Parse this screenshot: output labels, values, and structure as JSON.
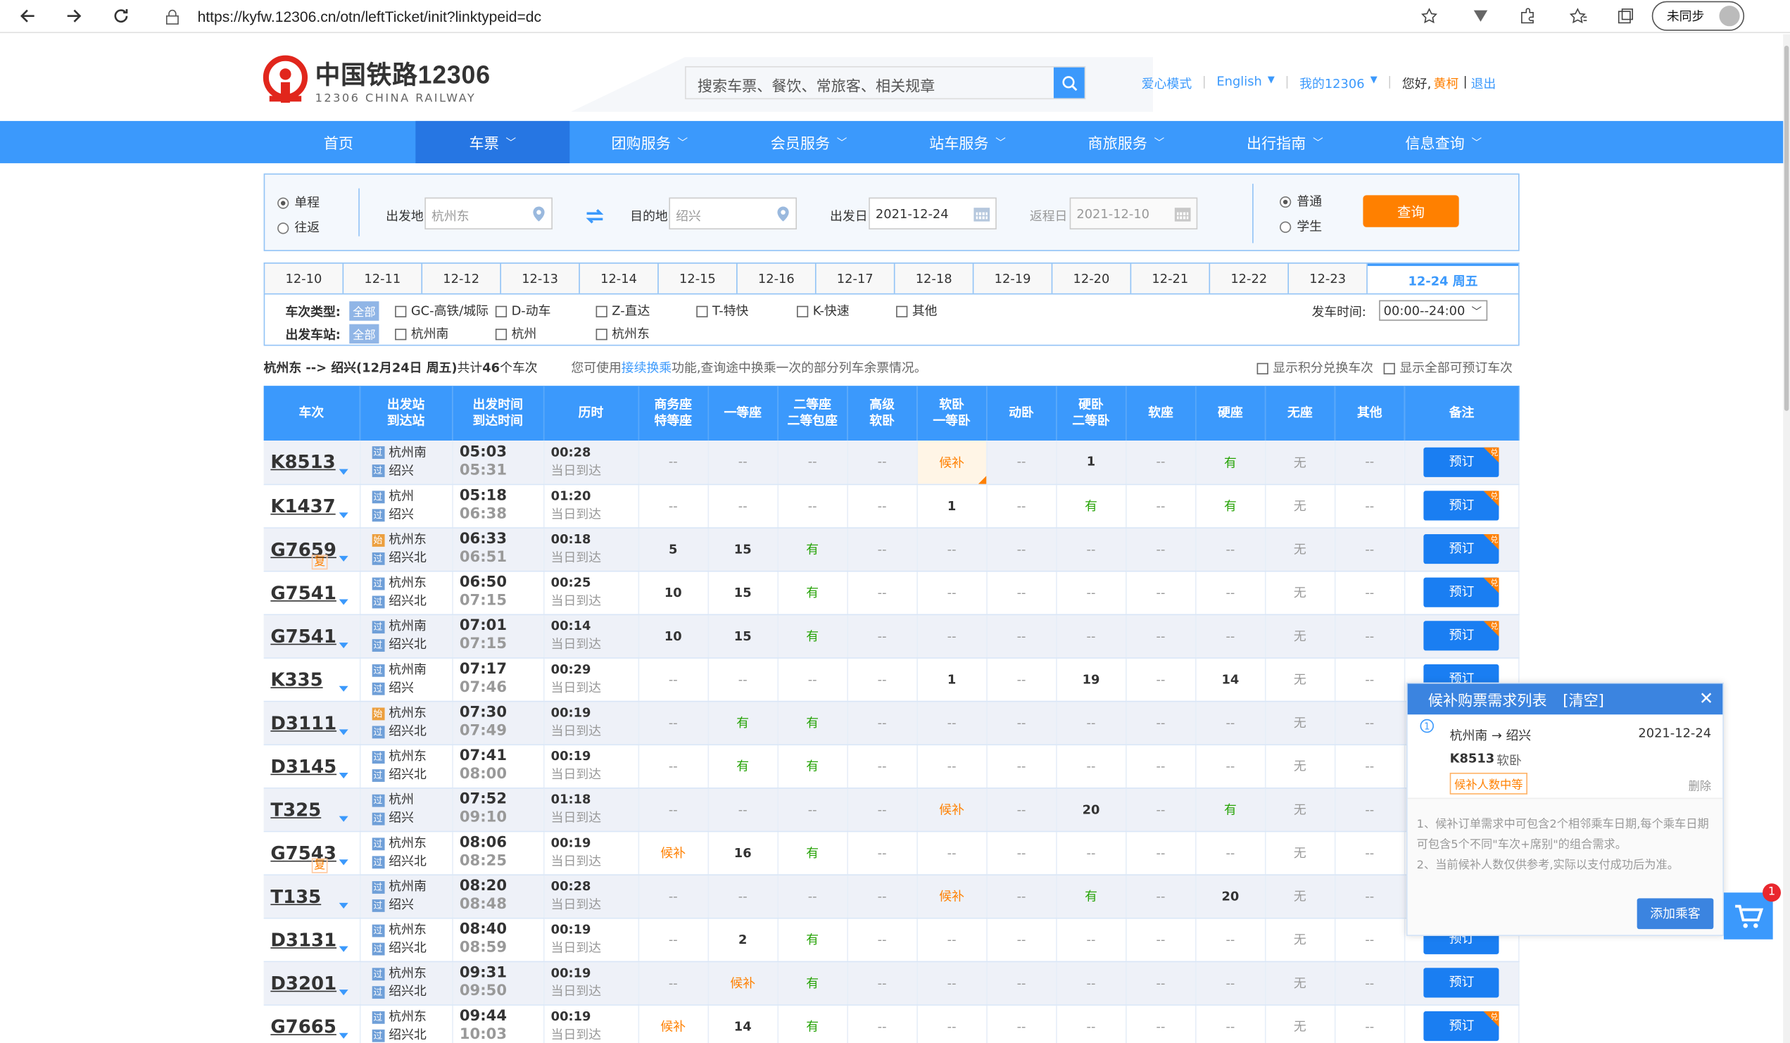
{
  "browser": {
    "url": "https://kyfw.12306.cn/otn/leftTicket/init?linktypeid=dc",
    "sync_label": "未同步"
  },
  "header": {
    "logo_title": "中国铁路12306",
    "logo_sub": "12306 CHINA RAILWAY",
    "search_placeholder": "搜索车票、餐饮、常旅客、相关规章",
    "links": {
      "care": "爱心模式",
      "english": "English",
      "my": "我的12306",
      "hello": "您好,",
      "user": "黄柯",
      "logout": "退出"
    }
  },
  "nav": [
    "首页",
    "车票",
    "团购服务",
    "会员服务",
    "站车服务",
    "商旅服务",
    "出行指南",
    "信息查询"
  ],
  "query": {
    "single": "单程",
    "round": "往返",
    "from_label": "出发地",
    "from": "杭州东",
    "to_label": "目的地",
    "to": "绍兴",
    "date_label": "出发日",
    "date": "2021-12-24",
    "ret_label": "返程日",
    "ret": "2021-12-10",
    "normal": "普通",
    "student": "学生",
    "btn": "查询"
  },
  "dates": [
    "12-10",
    "12-11",
    "12-12",
    "12-13",
    "12-14",
    "12-15",
    "12-16",
    "12-17",
    "12-18",
    "12-19",
    "12-20",
    "12-21",
    "12-22",
    "12-23",
    "12-24 周五"
  ],
  "filter": {
    "type_label": "车次类型:",
    "all": "全部",
    "types": [
      "GC-高铁/城际",
      "D-动车",
      "Z-直达",
      "T-特快",
      "K-快速",
      "其他"
    ],
    "time_label": "发车时间:",
    "time_value": "00:00--24:00",
    "station_label": "出发车站:",
    "stations": [
      "杭州南",
      "杭州",
      "杭州东"
    ]
  },
  "info": {
    "route": "杭州东 --> 绍兴",
    "date": "(12月24日 周五)",
    "total_pre": "共计",
    "total": "46",
    "total_post": "个车次",
    "tip_pre": "您可使用",
    "tip_link": "接续换乘",
    "tip_post": "功能,查询途中换乘一次的部分列车余票情况。",
    "opt1": "显示积分兑换车次",
    "opt2": "显示全部可预订车次"
  },
  "columns": [
    "车次",
    "出发站\n到达站",
    "出发时间\n到达时间",
    "历时",
    "商务座\n特等座",
    "一等座",
    "二等座\n二等包座",
    "高级\n软卧",
    "软卧\n一等卧",
    "动卧",
    "硬卧\n二等卧",
    "软座",
    "硬座",
    "无座",
    "其他",
    "备注"
  ],
  "book_label": "预订",
  "trains": [
    {
      "no": "K8513",
      "fu": "",
      "from": "杭州南",
      "fs": "过",
      "to": "绍兴",
      "dep": "05:03",
      "arr": "05:31",
      "dur": "00:28",
      "day": "当日到达",
      "seats": [
        "--",
        "--",
        "--",
        "--",
        "候补",
        "--",
        "1",
        "--",
        "有",
        "无",
        "--"
      ],
      "dui": true
    },
    {
      "no": "K1437",
      "fu": "",
      "from": "杭州",
      "fs": "过",
      "to": "绍兴",
      "dep": "05:18",
      "arr": "06:38",
      "dur": "01:20",
      "day": "当日到达",
      "seats": [
        "--",
        "--",
        "--",
        "--",
        "1",
        "--",
        "有",
        "--",
        "有",
        "无",
        "--"
      ],
      "dui": true
    },
    {
      "no": "G7659",
      "fu": "复",
      "from": "杭州东",
      "fs": "始",
      "to": "绍兴北",
      "dep": "06:33",
      "arr": "06:51",
      "dur": "00:18",
      "day": "当日到达",
      "seats": [
        "5",
        "15",
        "有",
        "--",
        "--",
        "--",
        "--",
        "--",
        "--",
        "无",
        "--"
      ],
      "dui": true
    },
    {
      "no": "G7541",
      "fu": "",
      "from": "杭州东",
      "fs": "过",
      "to": "绍兴北",
      "dep": "06:50",
      "arr": "07:15",
      "dur": "00:25",
      "day": "当日到达",
      "seats": [
        "10",
        "15",
        "有",
        "--",
        "--",
        "--",
        "--",
        "--",
        "--",
        "无",
        "--"
      ],
      "dui": true
    },
    {
      "no": "G7541",
      "fu": "",
      "from": "杭州南",
      "fs": "过",
      "to": "绍兴北",
      "dep": "07:01",
      "arr": "07:15",
      "dur": "00:14",
      "day": "当日到达",
      "seats": [
        "10",
        "15",
        "有",
        "--",
        "--",
        "--",
        "--",
        "--",
        "--",
        "无",
        "--"
      ],
      "dui": true
    },
    {
      "no": "K335",
      "fu": "",
      "from": "杭州南",
      "fs": "过",
      "to": "绍兴",
      "dep": "07:17",
      "arr": "07:46",
      "dur": "00:29",
      "day": "当日到达",
      "seats": [
        "--",
        "--",
        "--",
        "--",
        "1",
        "--",
        "19",
        "--",
        "14",
        "无",
        "--"
      ],
      "dui": false
    },
    {
      "no": "D3111",
      "fu": "",
      "from": "杭州东",
      "fs": "始",
      "to": "绍兴北",
      "dep": "07:30",
      "arr": "07:49",
      "dur": "00:19",
      "day": "当日到达",
      "seats": [
        "--",
        "有",
        "有",
        "--",
        "--",
        "--",
        "--",
        "--",
        "--",
        "无",
        "--"
      ],
      "dui": false
    },
    {
      "no": "D3145",
      "fu": "",
      "from": "杭州东",
      "fs": "过",
      "to": "绍兴北",
      "dep": "07:41",
      "arr": "08:00",
      "dur": "00:19",
      "day": "当日到达",
      "seats": [
        "--",
        "有",
        "有",
        "--",
        "--",
        "--",
        "--",
        "--",
        "--",
        "无",
        "--"
      ],
      "dui": false
    },
    {
      "no": "T325",
      "fu": "",
      "from": "杭州",
      "fs": "过",
      "to": "绍兴",
      "dep": "07:52",
      "arr": "09:10",
      "dur": "01:18",
      "day": "当日到达",
      "seats": [
        "--",
        "--",
        "--",
        "--",
        "候补",
        "--",
        "20",
        "--",
        "有",
        "无",
        "--"
      ],
      "dui": false
    },
    {
      "no": "G7543",
      "fu": "复",
      "from": "杭州东",
      "fs": "过",
      "to": "绍兴北",
      "dep": "08:06",
      "arr": "08:25",
      "dur": "00:19",
      "day": "当日到达",
      "seats": [
        "候补",
        "16",
        "有",
        "--",
        "--",
        "--",
        "--",
        "--",
        "--",
        "无",
        "--"
      ],
      "dui": false
    },
    {
      "no": "T135",
      "fu": "",
      "from": "杭州南",
      "fs": "过",
      "to": "绍兴",
      "dep": "08:20",
      "arr": "08:48",
      "dur": "00:28",
      "day": "当日到达",
      "seats": [
        "--",
        "--",
        "--",
        "--",
        "候补",
        "--",
        "有",
        "--",
        "20",
        "无",
        "--"
      ],
      "dui": false
    },
    {
      "no": "D3131",
      "fu": "",
      "from": "杭州东",
      "fs": "过",
      "to": "绍兴北",
      "dep": "08:40",
      "arr": "08:59",
      "dur": "00:19",
      "day": "当日到达",
      "seats": [
        "--",
        "2",
        "有",
        "--",
        "--",
        "--",
        "--",
        "--",
        "--",
        "无",
        "--"
      ],
      "dui": false
    },
    {
      "no": "D3201",
      "fu": "",
      "from": "杭州东",
      "fs": "过",
      "to": "绍兴北",
      "dep": "09:31",
      "arr": "09:50",
      "dur": "00:19",
      "day": "当日到达",
      "seats": [
        "--",
        "候补",
        "有",
        "--",
        "--",
        "--",
        "--",
        "--",
        "--",
        "无",
        "--"
      ],
      "dui": false
    },
    {
      "no": "G7665",
      "fu": "",
      "from": "杭州东",
      "fs": "过",
      "to": "绍兴北",
      "dep": "09:44",
      "arr": "10:03",
      "dur": "00:19",
      "day": "当日到达",
      "seats": [
        "候补",
        "14",
        "有",
        "--",
        "--",
        "--",
        "--",
        "--",
        "--",
        "无",
        "--"
      ],
      "dui": true
    }
  ],
  "panel": {
    "title": "候补购票需求列表",
    "clear": "[清空]",
    "idx": "1",
    "route": "杭州南 → 绍兴",
    "date": "2021-12-24",
    "train": "K8513",
    "seat": "软卧",
    "status": "候补人数中等",
    "del": "删除",
    "note1": "1、候补订单需求中可包含2个相邻乘车日期,每个乘车日期可包含5个不同\"车次+席别\"的组合需求。",
    "note2": "2、当前候补人数仅供参考,实际以支付成功后为准。",
    "add": "添加乘客"
  },
  "cart_badge": "1"
}
